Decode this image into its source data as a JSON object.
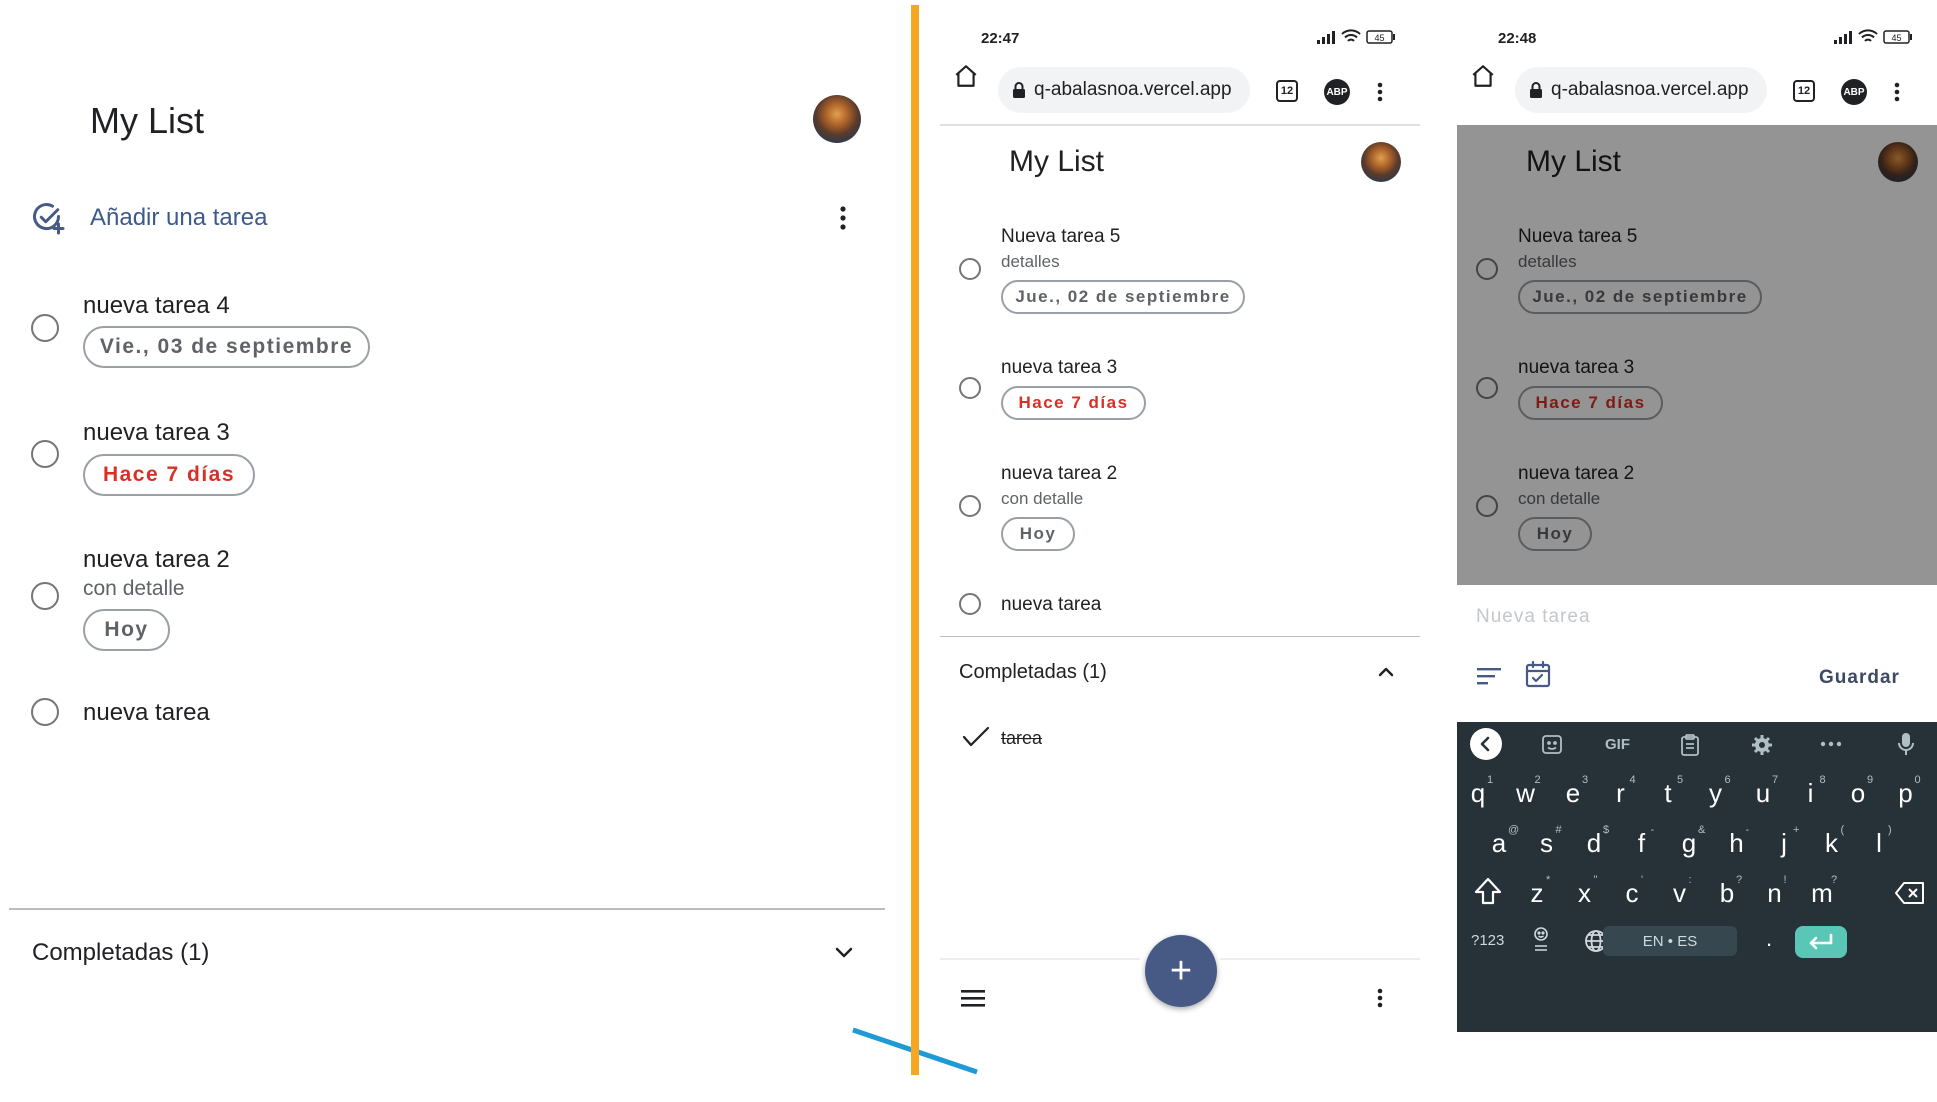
{
  "desktop": {
    "title": "My List",
    "add_task_label": "Añadir una tarea",
    "tasks": [
      {
        "title": "nueva tarea 4",
        "detail": "",
        "chip": "Vie., 03 de septiembre",
        "chip_overdue": false
      },
      {
        "title": "nueva tarea 3",
        "detail": "",
        "chip": "Hace 7 días",
        "chip_overdue": true
      },
      {
        "title": "nueva tarea 2",
        "detail": "con detalle",
        "chip": "Hoy",
        "chip_overdue": false
      },
      {
        "title": "nueva tarea",
        "detail": "",
        "chip": "",
        "chip_overdue": false
      }
    ],
    "completed_label": "Completadas (1)"
  },
  "phone1": {
    "time": "22:47",
    "battery": "45",
    "url": "q-abalasnoa.vercel.app",
    "tab_count": "12",
    "abp": "ABP",
    "title": "My List",
    "tasks": [
      {
        "title": "Nueva tarea 5",
        "detail": "detalles",
        "chip": "Jue., 02 de septiembre",
        "chip_overdue": false
      },
      {
        "title": "nueva tarea 3",
        "detail": "",
        "chip": "Hace 7 días",
        "chip_overdue": true
      },
      {
        "title": "nueva tarea 2",
        "detail": "con detalle",
        "chip": "Hoy",
        "chip_overdue": false
      },
      {
        "title": "nueva tarea",
        "detail": "",
        "chip": "",
        "chip_overdue": false
      }
    ],
    "completed_label": "Completadas (1)",
    "completed_tasks": [
      {
        "title": "tarea"
      }
    ],
    "fab_label": "+"
  },
  "phone2": {
    "time": "22:48",
    "battery": "45",
    "url": "q-abalasnoa.vercel.app",
    "tab_count": "12",
    "abp": "ABP",
    "title": "My List",
    "tasks": [
      {
        "title": "Nueva tarea 5",
        "detail": "detalles",
        "chip": "Jue., 02 de septiembre",
        "chip_overdue": false
      },
      {
        "title": "nueva tarea 3",
        "detail": "",
        "chip": "Hace 7 días",
        "chip_overdue": true
      },
      {
        "title": "nueva tarea 2",
        "detail": "con detalle",
        "chip": "Hoy",
        "chip_overdue": false
      }
    ],
    "new_task_placeholder": "Nueva tarea",
    "save_label": "Guardar",
    "keyboard": {
      "toolbar": {
        "gif": "GIF"
      },
      "row1": [
        "q",
        "w",
        "e",
        "r",
        "t",
        "y",
        "u",
        "i",
        "o",
        "p"
      ],
      "row1_hints": [
        "1",
        "2",
        "3",
        "4",
        "5",
        "6",
        "7",
        "8",
        "9",
        "0"
      ],
      "row2": [
        "a",
        "s",
        "d",
        "f",
        "g",
        "h",
        "j",
        "k",
        "l"
      ],
      "row2_hints": [
        "@",
        "#",
        "$",
        "-",
        "&",
        "-",
        "+",
        "(",
        ")"
      ],
      "row3": [
        "z",
        "x",
        "c",
        "v",
        "b",
        "n",
        "m"
      ],
      "row3_hints": [
        "*",
        "\"",
        "'",
        ":",
        "?",
        "!",
        "?"
      ],
      "symbols_key": "?123",
      "space_label": "EN • ES",
      "period_key": "."
    }
  },
  "colors": {
    "accent_blue": "#475a86",
    "overdue_red": "#d93025",
    "separator_orange": "#f5a623",
    "keyboard_bg": "#263238",
    "enter_key": "#5ac7b6"
  }
}
